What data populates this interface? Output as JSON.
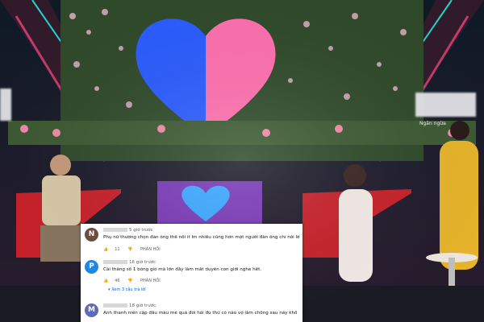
{
  "comments": [
    {
      "avatar_letter": "N",
      "avatar_color": "#6d4c41",
      "time": "5 giờ trước",
      "text": "Phụ nữ thường chọn đàn ông thế nổi ít lm nhiều cũng hơn một người đàn ông chỉ nói lời sáo",
      "likes": "11",
      "reply_label": "PHẢN HỒI"
    },
    {
      "avatar_letter": "P",
      "avatar_color": "#1e88e5",
      "time": "16 giờ trước",
      "text": "Cái thằng số 1 bóng gió mà lớn đây làm mất duyên con giới nghe hết.",
      "likes": "46",
      "reply_label": "PHẢN HỒI",
      "view_replies": "Xem 3 câu trả lời"
    },
    {
      "avatar_letter": "M",
      "avatar_color": "#5c6bc0",
      "time": "18 giờ trước",
      "text": "Anh thanh niên cặp đầu màu mè quá đòi hỏi đủ thứ có nào vợ lâm chồng sau này khổ"
    }
  ],
  "stage": {
    "sign_text": "Ngăn ngừa",
    "heart_left_color": "#2a5cff",
    "heart_right_color": "#ff6fae"
  }
}
